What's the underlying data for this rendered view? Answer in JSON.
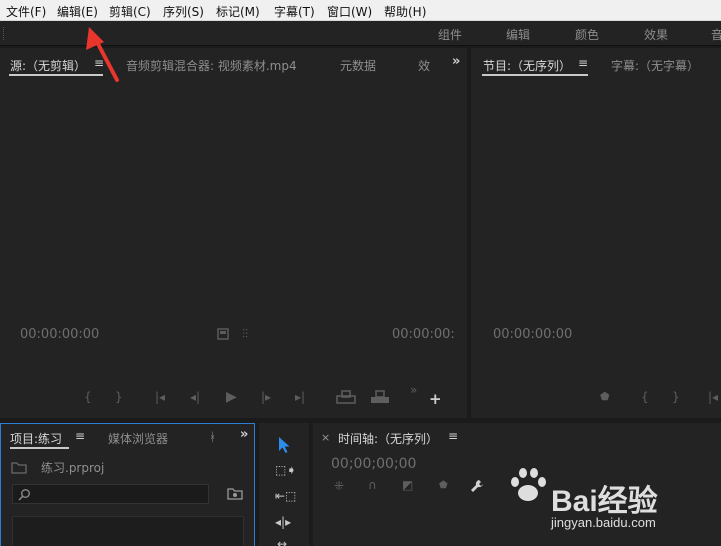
{
  "menubar": {
    "items": [
      "文件(F)",
      "编辑(E)",
      "剪辑(C)",
      "序列(S)",
      "标记(M)",
      "字幕(T)",
      "窗口(W)",
      "帮助(H)"
    ]
  },
  "workspace": {
    "tabs": [
      "组件",
      "编辑",
      "颜色",
      "效果",
      "音"
    ]
  },
  "source_panel": {
    "tabs": [
      "源:（无剪辑）",
      "音频剪辑混合器: 视频素材.mp4",
      "元数据",
      "效"
    ],
    "timecode_left": "00:00:00:00",
    "timecode_right": "00:00:00:"
  },
  "program_panel": {
    "tabs": [
      "节目:（无序列）",
      "字幕:（无字幕）"
    ],
    "timecode": "00:00:00:00"
  },
  "project_panel": {
    "tabs": [
      "项目:练习",
      "媒体浏览器"
    ],
    "file_name": "练习.prproj",
    "search_value": ""
  },
  "timeline_panel": {
    "close_glyph": "×",
    "title": "时间轴:（无序列）",
    "timecode": "00;00;00;00"
  },
  "glyphs": {
    "menu": "≡",
    "overflow": "»",
    "mark_in": "{",
    "mark_out": "}",
    "goto_in": "|◂",
    "step_back": "◂|",
    "play": "▶",
    "step_fwd": "|▸",
    "goto_out": "▸|",
    "add": "+",
    "marker": "⬟"
  },
  "watermark": {
    "logo": "Bai经验",
    "url": "jingyan.baidu.com"
  },
  "colors": {
    "annotation_arrow": "#e8362d",
    "selection_tool": "#2d8ceb",
    "active_panel_border": "#2d7fd6"
  }
}
